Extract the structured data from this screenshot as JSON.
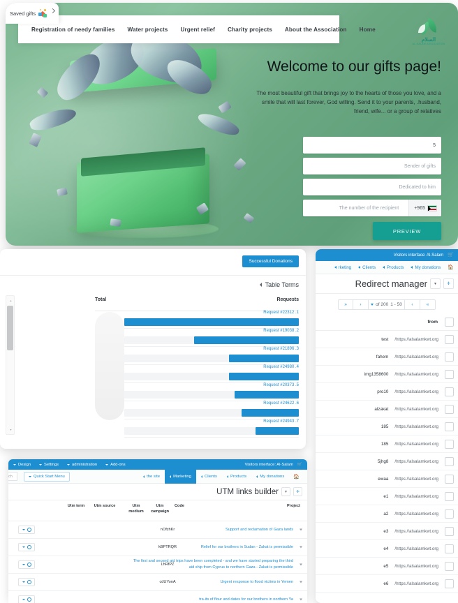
{
  "browser_tab": {
    "label": "Saved gifts",
    "icon": "confetti-icon",
    "chevron": "›"
  },
  "hero": {
    "nav": [
      {
        "label": "Registration of needy families"
      },
      {
        "label": "Water projects"
      },
      {
        "label": "Urgent relief"
      },
      {
        "label": "Charity projects"
      },
      {
        "label": "About the Association"
      },
      {
        "label": "Home"
      }
    ],
    "brand": {
      "name": "السلام",
      "sub": "AL-SALAM ASSOCIATION"
    },
    "title": "!Welcome to our gifts page",
    "description": "The most beautiful gift that brings joy to the hearts of those you love, and a smile that will last forever, God willing. Send it to your parents, .husband, friend, wife... or a group of relatives",
    "form": {
      "amount_value": "5",
      "sender_placeholder": "Sender of gifts",
      "dedicated_placeholder": "Dedicated to him",
      "recipient_placeholder": "The number of the recipient",
      "phone_code": "+965",
      "phone_flag": "kuwait-flag-icon",
      "preview_button": "PREVIEW"
    },
    "accent_color": "#159f93",
    "background_color": "#7cbd8e"
  },
  "chart_panel": {
    "success_button": "Successful Donations",
    "table_terms": "Table Terms",
    "col_total": "Total",
    "col_requests": "Requests",
    "accent_color": "#1d8ecf"
  },
  "chart_data": {
    "type": "bar",
    "title": "Requests",
    "xlabel": "Total",
    "ylabel": "Requests",
    "orientation": "horizontal",
    "grid": false,
    "legend": false,
    "xlim": [
      0,
      100
    ],
    "categories": [
      "Request #22312 .1",
      "Request #19038 .2",
      "Request #21896 .3",
      "Request #24980 .4",
      "Request #20373 .5",
      "Request #24622 .6",
      "Request #24943 .7"
    ],
    "values": [
      100,
      60,
      40,
      40,
      37,
      33,
      25
    ]
  },
  "redirect_panel": {
    "topbar": {
      "label": "Visitors interface: Al-Salam",
      "cart_icon": "cart-icon"
    },
    "menu": [
      {
        "label": "My donations"
      },
      {
        "label": "Products"
      },
      {
        "label": "Clients"
      },
      {
        "label": "rketing"
      }
    ],
    "home_icon": "home-icon",
    "title": "Redirect manager",
    "btn_caret": "▾",
    "btn_plus": "✛",
    "pager": {
      "first": "»",
      "prev": "›",
      "range": "1 - 50",
      "of": "of 200",
      "next": "‹",
      "last": "«"
    },
    "column_from": "from",
    "rows": [
      {
        "name": "test",
        "url": "/https://alsalamkwt.org"
      },
      {
        "name": "fahem",
        "url": "/https://alsalamkwt.org"
      },
      {
        "name": "img1358600",
        "url": "/https://alsalamkwt.org"
      },
      {
        "name": "pro10",
        "url": "/https://alsalamkwt.org"
      },
      {
        "name": "alzakat",
        "url": "/https://alsalamkwt.org"
      },
      {
        "name": "185",
        "url": "/https://alsalamkwt.org"
      },
      {
        "name": "185",
        "url": "/https://alsalamkwt.org"
      },
      {
        "name": "5jhg8",
        "url": "/https://alsalamkwt.org"
      },
      {
        "name": "ewaa",
        "url": "/https://alsalamkwt.org"
      },
      {
        "name": "e1",
        "url": "/https://alsalamkwt.org"
      },
      {
        "name": "a2",
        "url": "/https://alsalamkwt.org"
      },
      {
        "name": "e3",
        "url": "/https://alsalamkwt.org"
      },
      {
        "name": "e4",
        "url": "/https://alsalamkwt.org"
      },
      {
        "name": "e5",
        "url": "/https://alsalamkwt.org"
      },
      {
        "name": "e6",
        "url": "/https://alsalamkwt.org"
      }
    ]
  },
  "utm_panel": {
    "topbar": {
      "items": [
        {
          "label": "Design"
        },
        {
          "label": "Settings"
        },
        {
          "label": "administration"
        },
        {
          "label": "Add-ons"
        }
      ],
      "right_label": "Visitors interface: Al-Salam",
      "cart_icon": "cart-icon"
    },
    "search_value": "ch",
    "quick_start": "Quick Start Menu",
    "menu": [
      {
        "label": "the site",
        "active": false
      },
      {
        "label": "Marketing",
        "active": true
      },
      {
        "label": "Clients",
        "active": false
      },
      {
        "label": "Products",
        "active": false
      },
      {
        "label": "My donations",
        "active": false
      }
    ],
    "home_icon": "home-icon",
    "title": "UTM links builder",
    "btn_caret": "▾",
    "btn_plus": "✛",
    "columns": {
      "utm_term": "Utm term",
      "utm_source": "Utm source",
      "utm_medium": "Utm medium",
      "utm_campaign": "Utm campaign",
      "code": "Code",
      "project": "Project"
    },
    "rows": [
      {
        "code": "nOfzhKr",
        "project": "Support and reclamation of Gaza lands"
      },
      {
        "code": "kBPTRQR",
        "project": "Relief for our brothers in Sudan - Zakat is permissible"
      },
      {
        "code": "LhRfPZ",
        "project": "The first and second aid trips have been completed - and we have started preparing the third aid ship from Cyprus to northern Gaza - Zakat is permissible"
      },
      {
        "code": "cdUYonA",
        "project": "Urgent response to flood victims in Yemen"
      },
      {
        "code": "",
        "project": "tra-its of flour and dates for our brothers in northern Ya"
      }
    ]
  }
}
